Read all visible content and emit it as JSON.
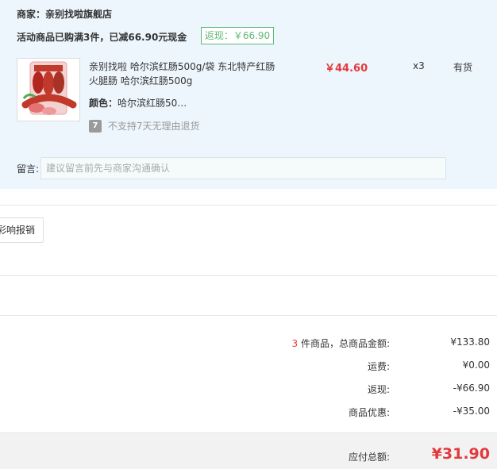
{
  "shop": {
    "merchant_label": "商家：",
    "merchant_name": "亲别找啦旗舰店",
    "promo_text": "活动商品已购满3件，已减66.90元现金",
    "rebate_tag": "返现：￥66.90"
  },
  "item": {
    "title_line1": "亲别找啦 哈尔滨红肠500g/袋 东北特产红肠",
    "title_line2": "火腿肠 哈尔滨红肠500g",
    "color_label": "颜色：",
    "color_value": "哈尔滨红肠50…",
    "no_return_icon": "7",
    "no_return_text": "不支持7天无理由退货",
    "price": "￥44.60",
    "quantity": "x3",
    "stock": "有货"
  },
  "message": {
    "label": "留言:",
    "placeholder": "建议留言前先与商家沟通确认"
  },
  "invoice_button": "彩响报销",
  "summary": {
    "count": "3",
    "count_label": "件商品，总商品金额:",
    "goods_total": "¥133.80",
    "shipping_label": "运费:",
    "shipping": "¥0.00",
    "cashback_label": "返现:",
    "cashback": "-¥66.90",
    "discount_label": "商品优惠:",
    "discount": "-¥35.00",
    "payable_label": "应付总额:",
    "payable": "¥31.90"
  },
  "colors": {
    "accent_red": "#e4393c",
    "rebate_green": "#5fb878",
    "shop_bg": "#edf6fd"
  }
}
